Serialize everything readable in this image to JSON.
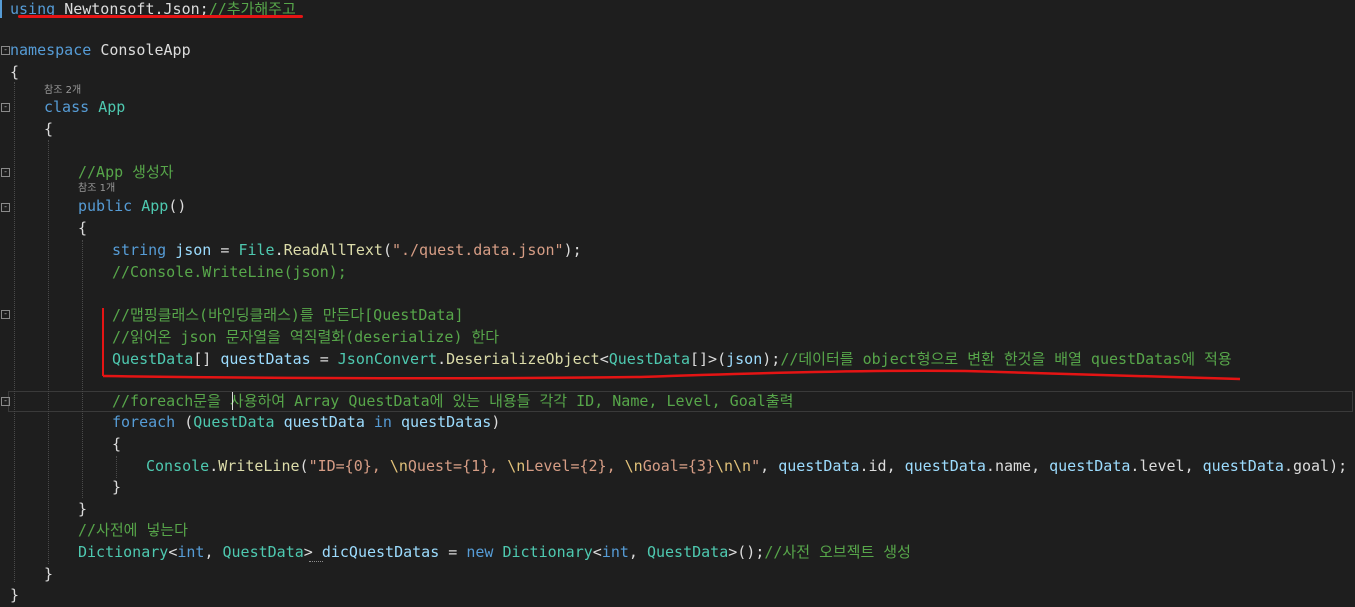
{
  "editor": {
    "codelens": {
      "class_refs": "참조 2개",
      "ctor_refs": "참조 1개"
    },
    "lines": {
      "using": {
        "kw": "using",
        "ns": "Newtonsoft.Json;",
        "comment": "//추가해주고"
      },
      "namespace": {
        "kw": "namespace",
        "name": "ConsoleApp"
      },
      "brace_open_ns": "{",
      "class_decl": {
        "kw": "class",
        "name": "App"
      },
      "brace_open_class": "{",
      "comment_ctor": "//App 생성자",
      "ctor_decl": {
        "kw": "public",
        "name": "App",
        "tail": "()"
      },
      "brace_open_ctor": "{",
      "read_json": {
        "kw": "string",
        "var": "json",
        "eq": " = ",
        "cls": "File",
        "dot": ".",
        "method": "ReadAllText",
        "open": "(",
        "str": "\"./quest.data.json\"",
        "close": ");"
      },
      "comment_console": "//Console.WriteLine(json);",
      "comment_mapping": "//맵핑클래스(바인딩클래스)를 만든다[QuestData]",
      "comment_deserialize": "//읽어온 json 문자열을 역직렬화(deserialize) 한다",
      "deserialize": {
        "type": "QuestData",
        "arr": "[] ",
        "var": "questDatas",
        "eq": " = ",
        "cls": "JsonConvert",
        "dot": ".",
        "method": "DeserializeObject",
        "lt": "<",
        "targ": "QuestData",
        "gt": "[]>(",
        "arg": "json",
        "close": ");",
        "comment": "//데이터를 object형으로 변환 한것을 배열 questDatas에 적용"
      },
      "comment_foreach_a": "//foreach문을 ",
      "comment_foreach_b": "사용하여 Array QuestData에 있는 내용들 각각 ID, Name, Level, Goal출력",
      "foreach": {
        "kw": "foreach",
        "open": " (",
        "type": "QuestData",
        "var": "questData",
        "in": "in",
        "coll": "questDatas",
        "close": ")"
      },
      "brace_open_foreach": "{",
      "writeline": {
        "cls": "Console",
        "dot": ".",
        "method": "WriteLine",
        "open": "(",
        "s1": "\"ID={0}, ",
        "e1": "\\n",
        "s2": "Quest={1}, ",
        "e2": "\\n",
        "s3": "Level={2}, ",
        "e3": "\\n",
        "s4": "Goal={3}",
        "e4": "\\n\\n",
        "s5": "\"",
        "args": [
          {
            "obj": "questData",
            "prop": "id"
          },
          {
            "obj": "questData",
            "prop": "name"
          },
          {
            "obj": "questData",
            "prop": "level"
          },
          {
            "obj": "questData",
            "prop": "goal"
          }
        ],
        "close": ");"
      },
      "brace_close_foreach": "}",
      "brace_close_ctor": "}",
      "comment_dict": "//사전에 넣는다",
      "dict": {
        "cls": "Dictionary",
        "lt": "<",
        "kw_int": "int",
        "comma": ", ",
        "type": "QuestData",
        "gt": "> ",
        "var": "dicQuestDatas",
        "eq": " = ",
        "kw_new": "new",
        "cls2": "Dictionary",
        "lt2": "<",
        "kw_int2": "int",
        "comma2": ", ",
        "type2": "QuestData",
        "gt2": ">();",
        "comment": "//사전 오브젝트 생성"
      },
      "brace_close_class": "}",
      "brace_close_ns": "}"
    },
    "fold_icons": {
      "collapse_glyph": "-"
    },
    "colors": {
      "background": "#1e1e1e",
      "keyword": "#569cd6",
      "type": "#4ec9b0",
      "string": "#d69d85",
      "comment": "#57a64a",
      "method": "#dcdcaa",
      "variable": "#9cdcfe",
      "annotation_red": "#e51414"
    }
  }
}
